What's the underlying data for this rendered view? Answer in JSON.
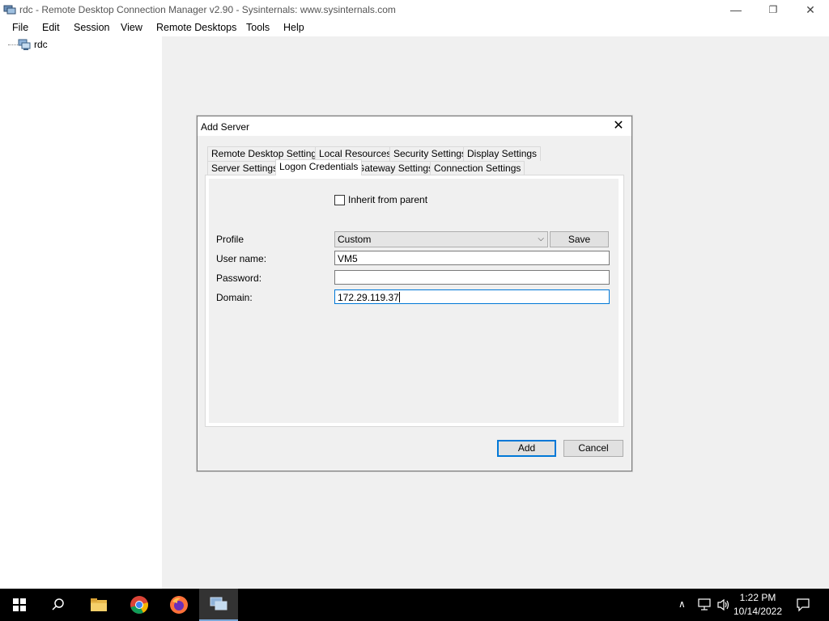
{
  "window": {
    "title": "rdc - Remote Desktop Connection Manager v2.90 - Sysinternals: www.sysinternals.com",
    "minimize_glyph": "—",
    "restore_glyph": "❐",
    "close_glyph": "✕"
  },
  "menu": [
    "File",
    "Edit",
    "Session",
    "View",
    "Remote Desktops",
    "Tools",
    "Help"
  ],
  "tree": {
    "root_label": "rdc",
    "root_icon": "server-group-icon"
  },
  "dialog": {
    "title": "Add Server",
    "close_glyph": "✕",
    "tabs_row1": [
      "Remote Desktop Settings",
      "Local Resources",
      "Security Settings",
      "Display Settings"
    ],
    "tabs_row2": [
      "Server Settings",
      "Logon Credentials",
      "Gateway Settings",
      "Connection Settings"
    ],
    "active_tab": "Logon Credentials",
    "inherit_label": "Inherit from parent",
    "inherit_checked": false,
    "profile_label": "Profile",
    "profile_value": "Custom",
    "save_label": "Save",
    "username_label": "User name:",
    "username_value": "VM5",
    "password_label": "Password:",
    "password_value": "",
    "domain_label": "Domain:",
    "domain_value": "172.29.119.37",
    "add_label": "Add",
    "cancel_label": "Cancel"
  },
  "taskbar": {
    "icons": [
      "windows-start-icon",
      "search-icon",
      "file-explorer-icon",
      "chrome-icon",
      "firefox-icon",
      "rdcman-icon"
    ],
    "time": "1:22 PM",
    "date": "10/14/2022",
    "tray_icons": [
      "chevron-up-icon",
      "network-icon",
      "volume-icon",
      "notifications-icon"
    ]
  }
}
